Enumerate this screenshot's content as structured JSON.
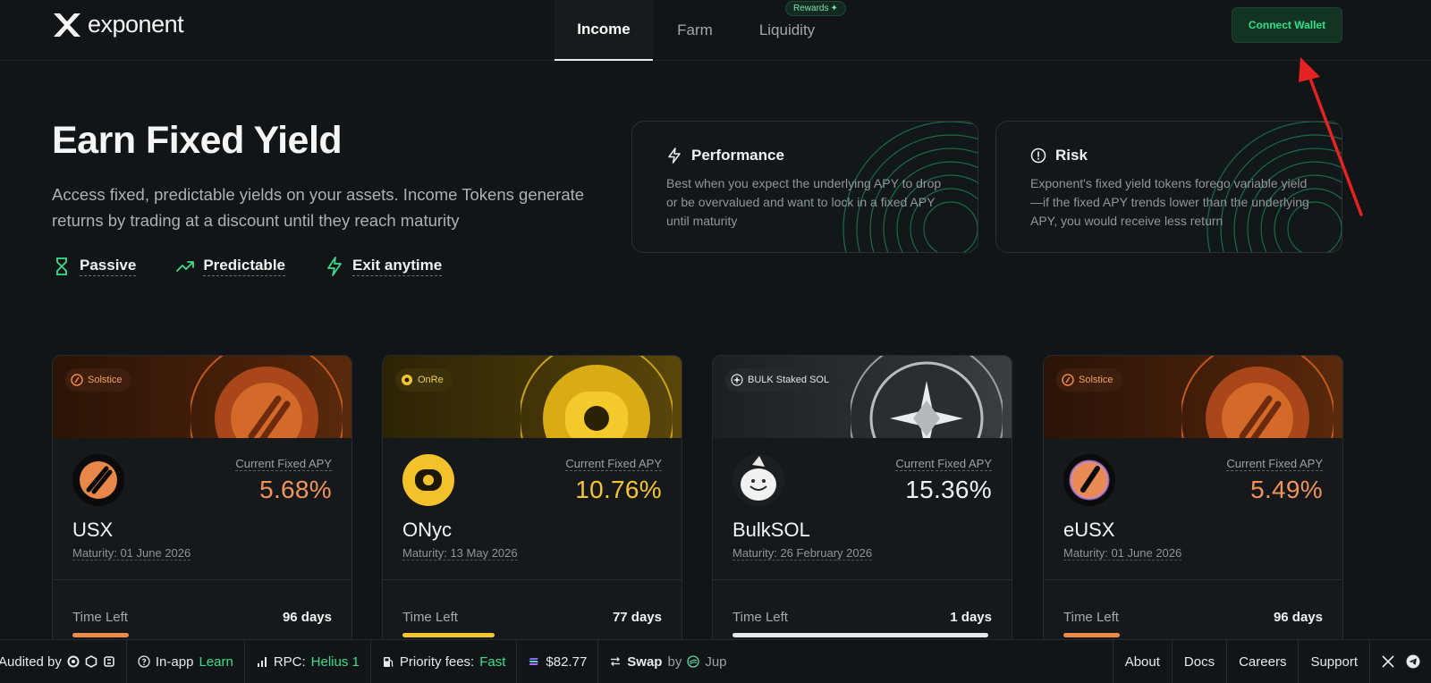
{
  "brand": {
    "name": "exponent"
  },
  "nav": {
    "tabs": [
      {
        "label": "Income",
        "active": true
      },
      {
        "label": "Farm",
        "active": false
      },
      {
        "label": "Liquidity",
        "active": false
      }
    ],
    "rewards_badge": "Rewards"
  },
  "header": {
    "connect_label": "Connect Wallet"
  },
  "hero": {
    "title": "Earn Fixed Yield",
    "description": "Access fixed, predictable yields on your assets. Income Tokens generate returns by trading at a discount until they reach maturity",
    "features": [
      "Passive",
      "Predictable",
      "Exit anytime"
    ]
  },
  "info_cards": [
    {
      "title": "Performance",
      "icon": "lightning-icon",
      "body": "Best when you expect the underlying APY to drop or be overvalued and want to lock in a fixed APY until maturity"
    },
    {
      "title": "Risk",
      "icon": "alert-circle-icon",
      "body": "Exponent's fixed yield tokens forego variable yield—if the fixed APY trends lower than the underlying APY, you would receive less return"
    }
  ],
  "assets": [
    {
      "platform": "Solstice",
      "apy_label": "Current Fixed APY",
      "apy": "5.68%",
      "name": "USX",
      "maturity": "Maturity: 01 June 2026",
      "time_left_label": "Time Left",
      "time_left": "96 days",
      "progress": 0.2,
      "color": "#f08a4b"
    },
    {
      "platform": "OnRe",
      "apy_label": "Current Fixed APY",
      "apy": "10.76%",
      "name": "ONyc",
      "maturity": "Maturity: 13 May 2026",
      "time_left_label": "Time Left",
      "time_left": "77 days",
      "progress": 0.35,
      "color": "#f5c531"
    },
    {
      "platform": "BULK Staked SOL",
      "apy_label": "Current Fixed APY",
      "apy": "15.36%",
      "name": "BulkSOL",
      "maturity": "Maturity: 26 February 2026",
      "time_left_label": "Time Left",
      "time_left": "1 days",
      "progress": 0.98,
      "color": "#e6e8ea"
    },
    {
      "platform": "Solstice",
      "apy_label": "Current Fixed APY",
      "apy": "5.49%",
      "name": "eUSX",
      "maturity": "Maturity: 01 June 2026",
      "time_left_label": "Time Left",
      "time_left": "96 days",
      "progress": 0.2,
      "color": "#f08a4b"
    }
  ],
  "footer": {
    "audited_label": "Audited by",
    "learn_prefix": "In-app",
    "learn_label": "Learn",
    "rpc_label": "RPC:",
    "rpc_value": "Helius 1",
    "fees_label": "Priority fees:",
    "fees_value": "Fast",
    "sol_price": "$82.77",
    "swap_label": "Swap",
    "swap_by": "by",
    "swap_provider": "Jup",
    "links": [
      "About",
      "Docs",
      "Careers",
      "Support"
    ]
  }
}
